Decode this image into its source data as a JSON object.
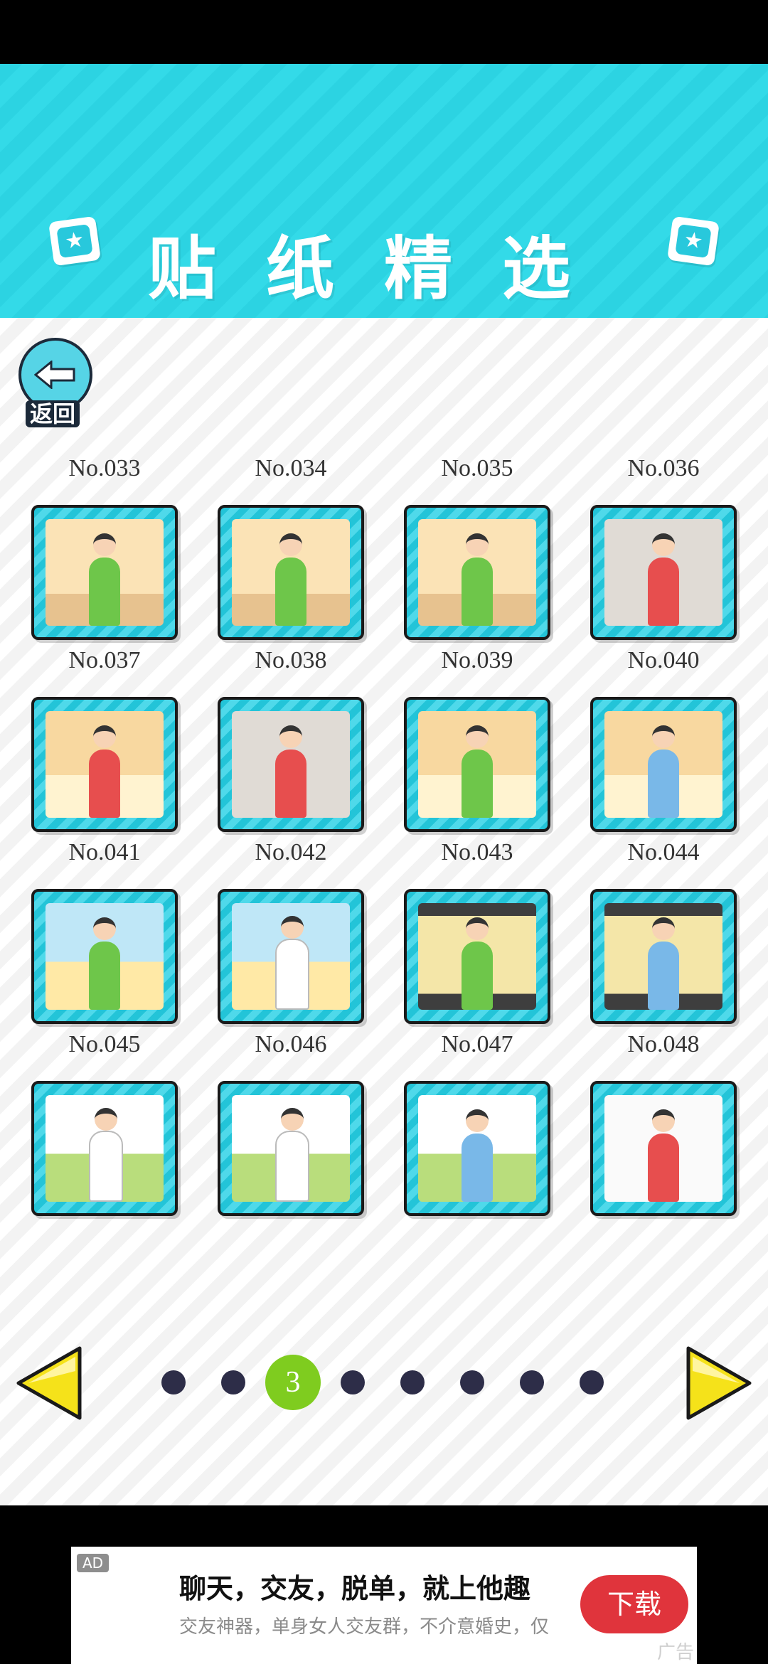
{
  "header": {
    "title": "贴纸精选",
    "icon_left": "star-badge-icon",
    "icon_right": "star-badge-icon"
  },
  "back": {
    "label": "返回",
    "icon": "back-arrow-icon"
  },
  "stickers": [
    {
      "label": "No.033",
      "scene": "a",
      "figure": "green"
    },
    {
      "label": "No.034",
      "scene": "a",
      "figure": "green"
    },
    {
      "label": "No.035",
      "scene": "a",
      "figure": "green"
    },
    {
      "label": "No.036",
      "scene": "dark",
      "figure": "red"
    },
    {
      "label": "No.037",
      "scene": "c",
      "figure": "red"
    },
    {
      "label": "No.038",
      "scene": "dark",
      "figure": "red"
    },
    {
      "label": "No.039",
      "scene": "c",
      "figure": "green"
    },
    {
      "label": "No.040",
      "scene": "c",
      "figure": "blue"
    },
    {
      "label": "No.041",
      "scene": "b",
      "figure": "green"
    },
    {
      "label": "No.042",
      "scene": "b",
      "figure": "white"
    },
    {
      "label": "No.043",
      "scene": "tv",
      "figure": "green"
    },
    {
      "label": "No.044",
      "scene": "tv",
      "figure": "blue"
    },
    {
      "label": "No.045",
      "scene": "field",
      "figure": "white"
    },
    {
      "label": "No.046",
      "scene": "field",
      "figure": "white"
    },
    {
      "label": "No.047",
      "scene": "field",
      "figure": "blue"
    },
    {
      "label": "No.048",
      "scene": "white",
      "figure": "red"
    }
  ],
  "pager": {
    "current": "3",
    "total_pages": 8,
    "current_index": 2,
    "prev_icon": "triangle-left-icon",
    "next_icon": "triangle-right-icon"
  },
  "ad": {
    "tag": "AD",
    "title": "聊天，交友，脱单，就上他趣",
    "subtitle": "交友神器，单身女人交友群，不介意婚史，仅",
    "button": "下载",
    "corner": "广告"
  },
  "colors": {
    "header": "#2cd3e2",
    "active_dot": "#7fcc1f",
    "arrow": "#f5e21a",
    "ad_button": "#e0343c"
  }
}
